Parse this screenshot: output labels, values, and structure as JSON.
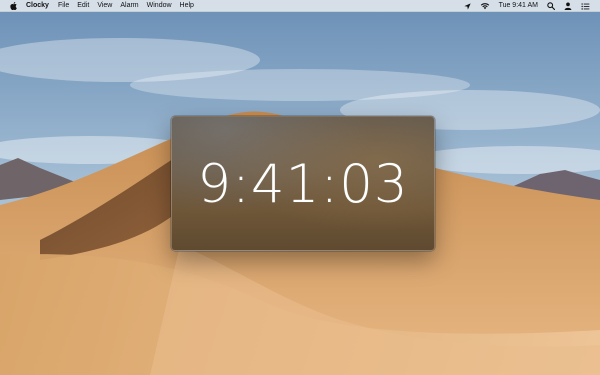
{
  "menubar": {
    "apple_icon": "apple-icon",
    "app_name": "Clocky",
    "menus": [
      "File",
      "Edit",
      "View",
      "Alarm",
      "Window",
      "Help"
    ],
    "status": {
      "location_icon": "location-arrow-icon",
      "wifi_icon": "wifi-icon",
      "clock": "Tue 9:41 AM",
      "search_icon": "search-icon",
      "user_icon": "user-icon",
      "menu_icon": "list-icon"
    }
  },
  "clock_window": {
    "time": "9:41:03"
  },
  "colors": {
    "menubar_bg": "#e8ecf0",
    "window_bg": "#6a5a46",
    "time_text": "#ffffff",
    "sky": "#8eaeca",
    "dune": "#c9955c"
  }
}
